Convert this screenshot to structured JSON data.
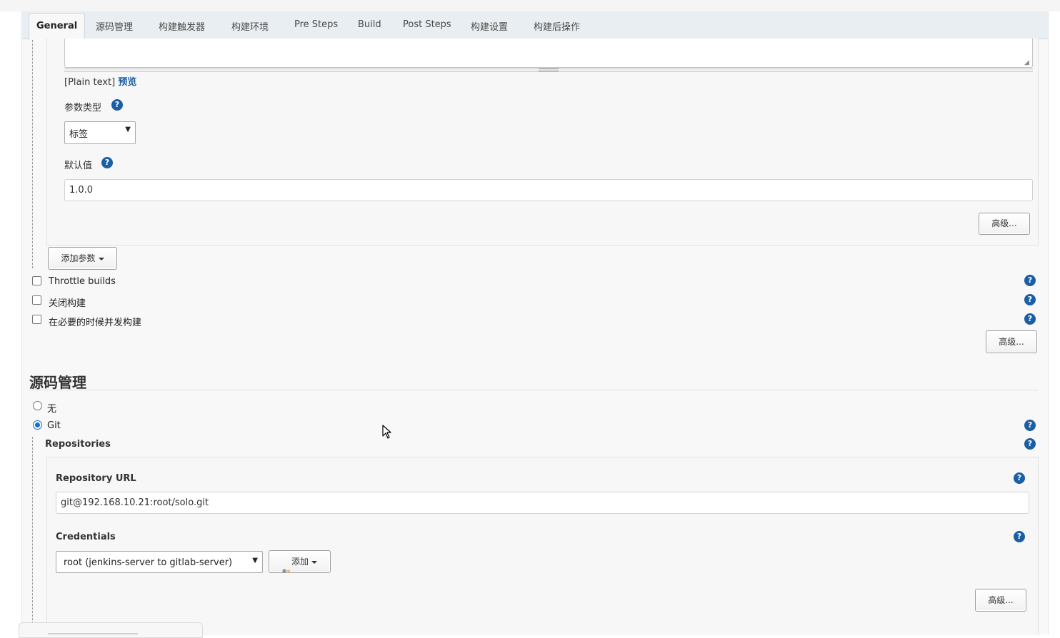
{
  "tabs": [
    {
      "label": "General",
      "active": true
    },
    {
      "label": "源码管理"
    },
    {
      "label": "构建触发器"
    },
    {
      "label": "构建环境"
    },
    {
      "label": "Pre Steps"
    },
    {
      "label": "Build"
    },
    {
      "label": "Post Steps"
    },
    {
      "label": "构建设置"
    },
    {
      "label": "构建后操作"
    }
  ],
  "param": {
    "format_text": "[Plain text]",
    "preview_link": "预览",
    "type_label": "参数类型",
    "type_value": "标签",
    "default_label": "默认值",
    "default_value": "1.0.0",
    "advanced_button": "高级..."
  },
  "add_param_button": "添加参数",
  "options": [
    {
      "label": "Throttle builds",
      "checked": false
    },
    {
      "label": "关闭构建",
      "checked": false
    },
    {
      "label": "在必要的时候并发构建",
      "checked": false
    }
  ],
  "general_advanced_button": "高级...",
  "scm": {
    "title": "源码管理",
    "none_label": "无",
    "git_label": "Git",
    "selected": "Git",
    "repositories_label": "Repositories",
    "repo_url_label": "Repository URL",
    "repo_url_value": "git@192.168.10.21:root/solo.git",
    "credentials_label": "Credentials",
    "credentials_value": "root (jenkins-server to gitlab-server)",
    "add_button": "添加",
    "advanced_button": "高级..."
  },
  "help_glyph": "?",
  "colors": {
    "help": "#1a5ea4",
    "radio_selected": "#0f6fd6",
    "link": "#1a5ea4"
  }
}
